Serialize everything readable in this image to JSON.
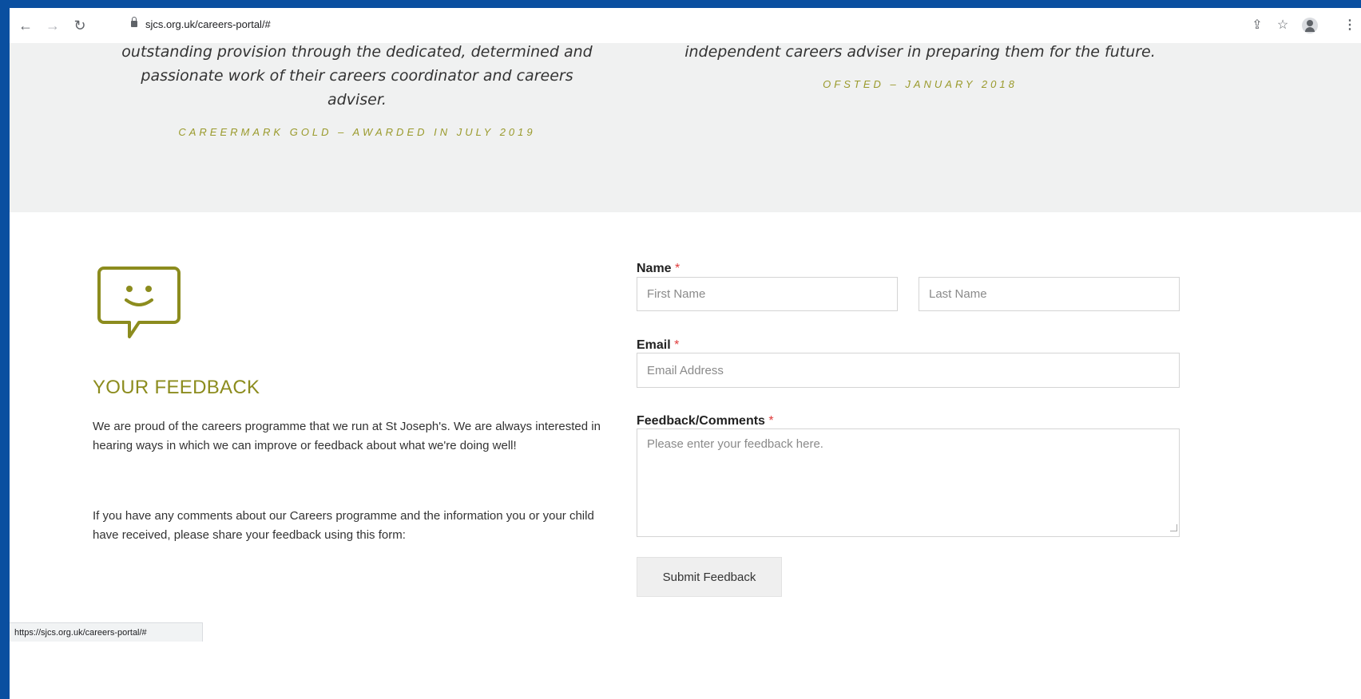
{
  "browser": {
    "url": "sjcs.org.uk/careers-portal/#",
    "status_url": "https://sjcs.org.uk/careers-portal/#"
  },
  "testimonials": [
    {
      "quote": "outstanding provision through the dedicated, determined and passionate work of their careers coordinator and careers adviser.",
      "source": "CAREERMARK GOLD – AWARDED IN JULY 2019"
    },
    {
      "quote": "independent careers adviser in preparing them for the future.",
      "source": "OFSTED – JANUARY 2018"
    }
  ],
  "feedback": {
    "icon": "chat-smile-icon",
    "title": "YOUR FEEDBACK",
    "paragraph1": "We are proud of the careers programme that we run at St Joseph's. We are always interested in hearing ways in which we can improve or feedback about what we're doing well!",
    "paragraph2": "If you have any comments about our Careers programme and the information you or your child have received, please share your feedback using this form:"
  },
  "form": {
    "name_label": "Name",
    "required_mark": "*",
    "first_name_placeholder": "First Name",
    "last_name_placeholder": "Last Name",
    "email_label": "Email",
    "email_placeholder": "Email Address",
    "feedback_label": "Feedback/Comments",
    "feedback_placeholder": "Please enter your feedback here.",
    "submit_label": "Submit Feedback"
  },
  "colors": {
    "accent": "#8c8c1e",
    "background_outer": "#0a4fa0",
    "band": "#f0f1f1"
  }
}
